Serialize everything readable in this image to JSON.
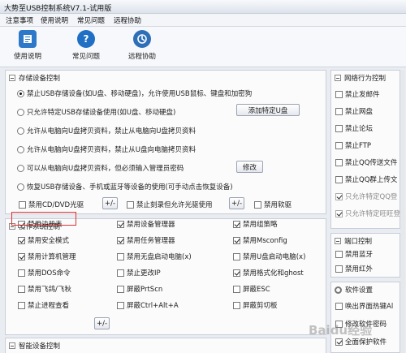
{
  "window": {
    "title": "大势至USB控制系统V7.1-试用版"
  },
  "menu": [
    "注意事项",
    "使用说明",
    "常见问题",
    "远程协助"
  ],
  "toolbar": [
    {
      "label": "使用说明",
      "icon": "help-book-icon",
      "color": "#2d78c8"
    },
    {
      "label": "常见问题",
      "icon": "question-icon",
      "color": "#1f6fc4"
    },
    {
      "label": "远程协助",
      "icon": "remote-icon",
      "color": "#2e6fb8"
    }
  ],
  "storage": {
    "title": "存储设备控制",
    "radios": [
      {
        "label": "禁止USB存储设备(如U盘、移动硬盘)，允许使用USB鼠标、键盘和加密狗",
        "checked": true
      },
      {
        "label": "只允许特定USB存储设备使用(如U盘、移动硬盘)",
        "checked": false
      },
      {
        "label": "允许从电脑向U盘拷贝资料，禁止从电脑向U盘拷贝资料",
        "checked": false
      },
      {
        "label": "允许从电脑向U盘拷贝资料，禁止从U盘向电脑拷贝资料",
        "checked": false
      },
      {
        "label": "可以从电脑向U盘拷贝资料，但必须输入管理员密码",
        "checked": false
      },
      {
        "label": "恢复USB存储设备、手机或蓝牙等设备的使用(可手动点击恢复设备)",
        "checked": false
      }
    ],
    "add_udisk_btn": "添加特定U盘",
    "modify_btn": "修改",
    "cd_label": "禁用CD/DVD光驱",
    "burn_label": "禁止刻录但允许光驱使用",
    "floppy_label": "禁用软驱",
    "plusminus": "+/-"
  },
  "os": {
    "title": "操作系统控制",
    "items": [
      {
        "label": "禁用注册表",
        "checked": true
      },
      {
        "label": "禁用设备管理器",
        "checked": true
      },
      {
        "label": "禁用组策略",
        "checked": true
      },
      {
        "label": "禁用安全模式",
        "checked": true
      },
      {
        "label": "禁用任务管理器",
        "checked": true
      },
      {
        "label": "禁用Msconfig",
        "checked": true
      },
      {
        "label": "禁用计算机管理",
        "checked": true
      },
      {
        "label": "禁用无盘启动电脑(x)",
        "checked": false
      },
      {
        "label": "禁用U盘启动电脑(x)",
        "checked": false
      },
      {
        "label": "禁用DOS命令",
        "checked": false
      },
      {
        "label": "禁止更改IP",
        "checked": false
      },
      {
        "label": "禁用格式化和ghost",
        "checked": true
      },
      {
        "label": "禁用飞鸽/飞秋",
        "checked": false
      },
      {
        "label": "屏蔽PrtScn",
        "checked": false
      },
      {
        "label": "屏蔽ESC",
        "checked": false
      },
      {
        "label": "禁止进程查看",
        "checked": false
      },
      {
        "label": "屏蔽Ctrl+Alt+A",
        "checked": false
      },
      {
        "label": "屏蔽剪切板",
        "checked": false
      }
    ],
    "plusminus": "+/-"
  },
  "smart": {
    "title": "智能设备控制"
  },
  "network": {
    "title": "网络行为控制",
    "items": [
      {
        "label": "禁止发邮件",
        "checked": false,
        "disabled": false
      },
      {
        "label": "禁止网盘",
        "checked": false,
        "disabled": false
      },
      {
        "label": "禁止论坛",
        "checked": false,
        "disabled": false
      },
      {
        "label": "禁止FTP",
        "checked": false,
        "disabled": false
      },
      {
        "label": "禁止QQ传送文件",
        "checked": false,
        "disabled": false
      },
      {
        "label": "禁止QQ群上传文",
        "checked": false,
        "disabled": false
      },
      {
        "label": "只允许特定QQ登",
        "checked": true,
        "disabled": true
      },
      {
        "label": "只允许特定旺旺登",
        "checked": true,
        "disabled": true
      }
    ]
  },
  "port": {
    "title": "端口控制",
    "items": [
      {
        "label": "禁用蓝牙",
        "checked": false
      },
      {
        "label": "禁用红外",
        "checked": false
      }
    ]
  },
  "software": {
    "title": "软件设置",
    "items": [
      {
        "label": "唤出界面热键Al",
        "checked": false
      },
      {
        "label": "修改软件密码",
        "checked": false
      },
      {
        "label": "全面保护软件",
        "checked": true
      }
    ]
  },
  "watermark": "Baidu经验"
}
